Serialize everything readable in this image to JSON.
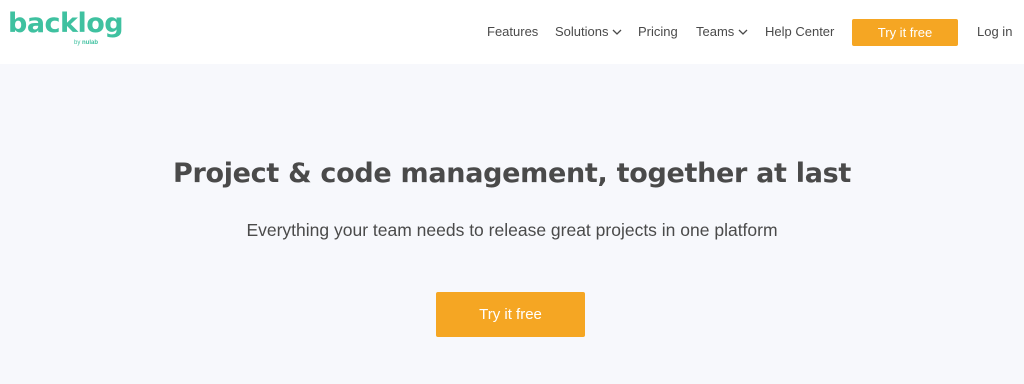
{
  "header": {
    "logo": {
      "word": "backlog",
      "by_prefix": "by",
      "by_brand": "nulab"
    },
    "nav": {
      "features": "Features",
      "solutions": "Solutions",
      "pricing": "Pricing",
      "teams": "Teams",
      "help_center": "Help Center",
      "login": "Log in"
    },
    "cta_label": "Try it free"
  },
  "hero": {
    "title": "Project & code management, together at last",
    "subtitle": "Everything your team needs to release great projects in one platform",
    "cta_label": "Try it free"
  },
  "colors": {
    "brand_green": "#3fc1a0",
    "accent_orange": "#f5a623",
    "background": "#f7f8fc",
    "header_bg": "#ffffff",
    "text": "#4a4a4a"
  },
  "icons": {
    "solutions_dropdown": "chevron-down-icon",
    "teams_dropdown": "chevron-down-icon"
  }
}
